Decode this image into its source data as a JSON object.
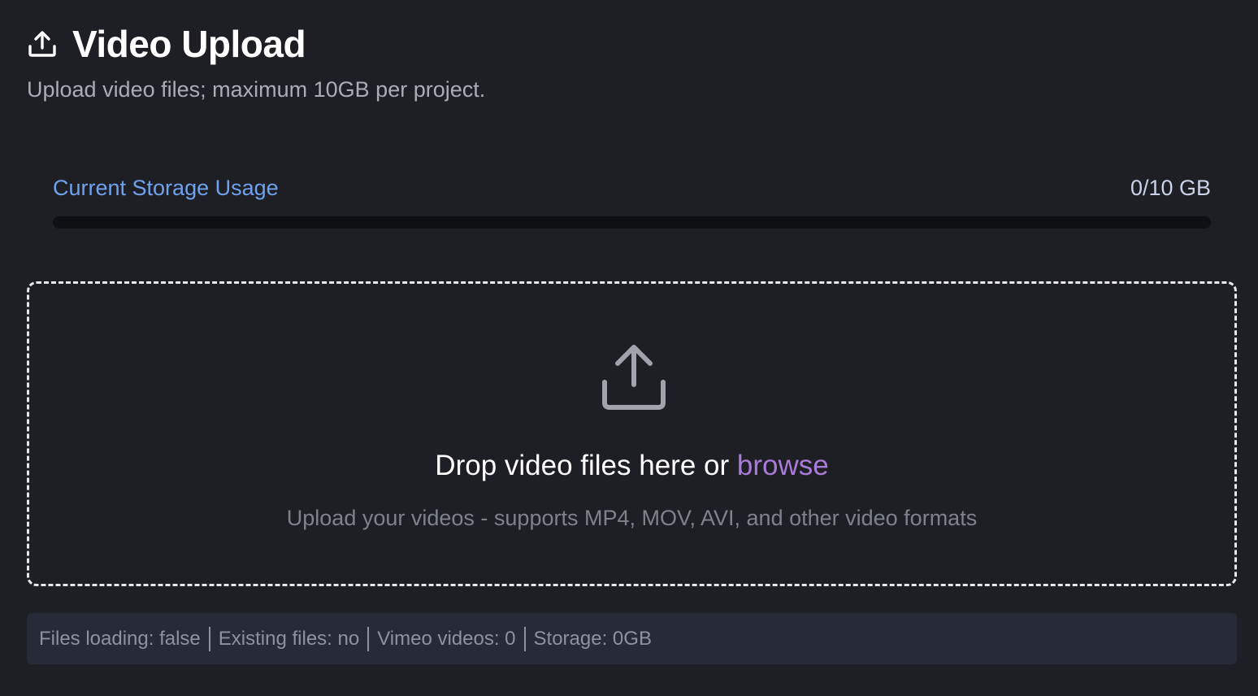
{
  "header": {
    "title": "Video Upload",
    "subtitle": "Upload video files; maximum 10GB per project.",
    "icon": "upload-icon"
  },
  "storage": {
    "label": "Current Storage Usage",
    "value": "0/10 GB",
    "used_gb": 0,
    "total_gb": 10,
    "progress_fraction": 0
  },
  "dropzone": {
    "icon": "upload-icon",
    "prompt": "Drop video files here or ",
    "browse_label": "browse",
    "hint": "Upload your videos - supports MP4, MOV, AVI, and other video formats"
  },
  "status": {
    "files_loading": "Files loading: false",
    "existing_files": "Existing files: no",
    "vimeo_videos": "Vimeo videos: 0",
    "storage": "Storage: 0GB"
  },
  "colors": {
    "background": "#1e1f24",
    "accent_blue": "#6ea1ee",
    "accent_purple": "#a97ad8",
    "status_bar": "#272b38"
  }
}
